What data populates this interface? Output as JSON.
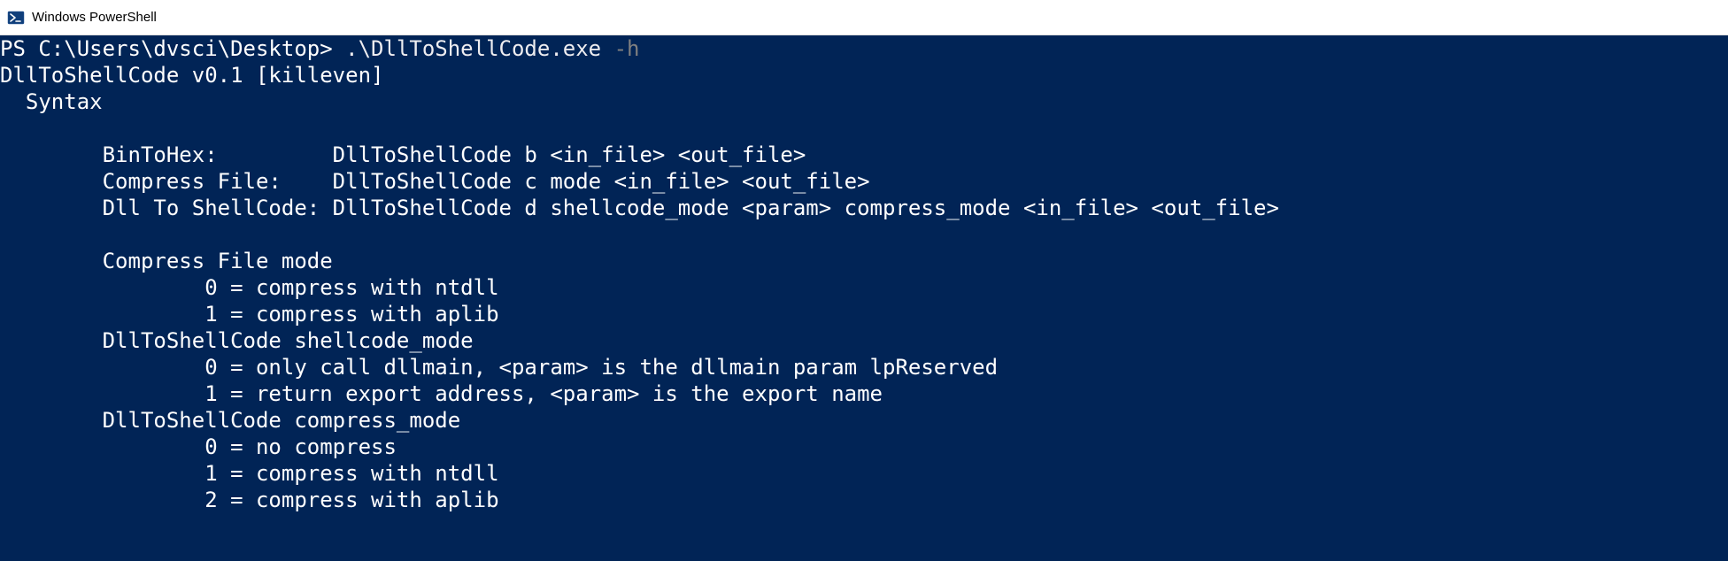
{
  "titleBar": {
    "title": "Windows PowerShell"
  },
  "console": {
    "prompt": "PS C:\\Users\\dvsci\\Desktop> ",
    "command": ".\\DllToShellCode.exe",
    "commandFlag": " -h",
    "lines": {
      "l1": "DllToShellCode v0.1 [killeven]",
      "l2": "  Syntax",
      "l3": "",
      "l4": "        BinToHex:         DllToShellCode b <in_file> <out_file>",
      "l5": "        Compress File:    DllToShellCode c mode <in_file> <out_file>",
      "l6": "        Dll To ShellCode: DllToShellCode d shellcode_mode <param> compress_mode <in_file> <out_file>",
      "l7": "",
      "l8": "        Compress File mode",
      "l9": "                0 = compress with ntdll",
      "l10": "                1 = compress with aplib",
      "l11": "        DllToShellCode shellcode_mode",
      "l12": "                0 = only call dllmain, <param> is the dllmain param lpReserved",
      "l13": "                1 = return export address, <param> is the export name",
      "l14": "        DllToShellCode compress_mode",
      "l15": "                0 = no compress",
      "l16": "                1 = compress with ntdll",
      "l17": "                2 = compress with aplib"
    }
  }
}
